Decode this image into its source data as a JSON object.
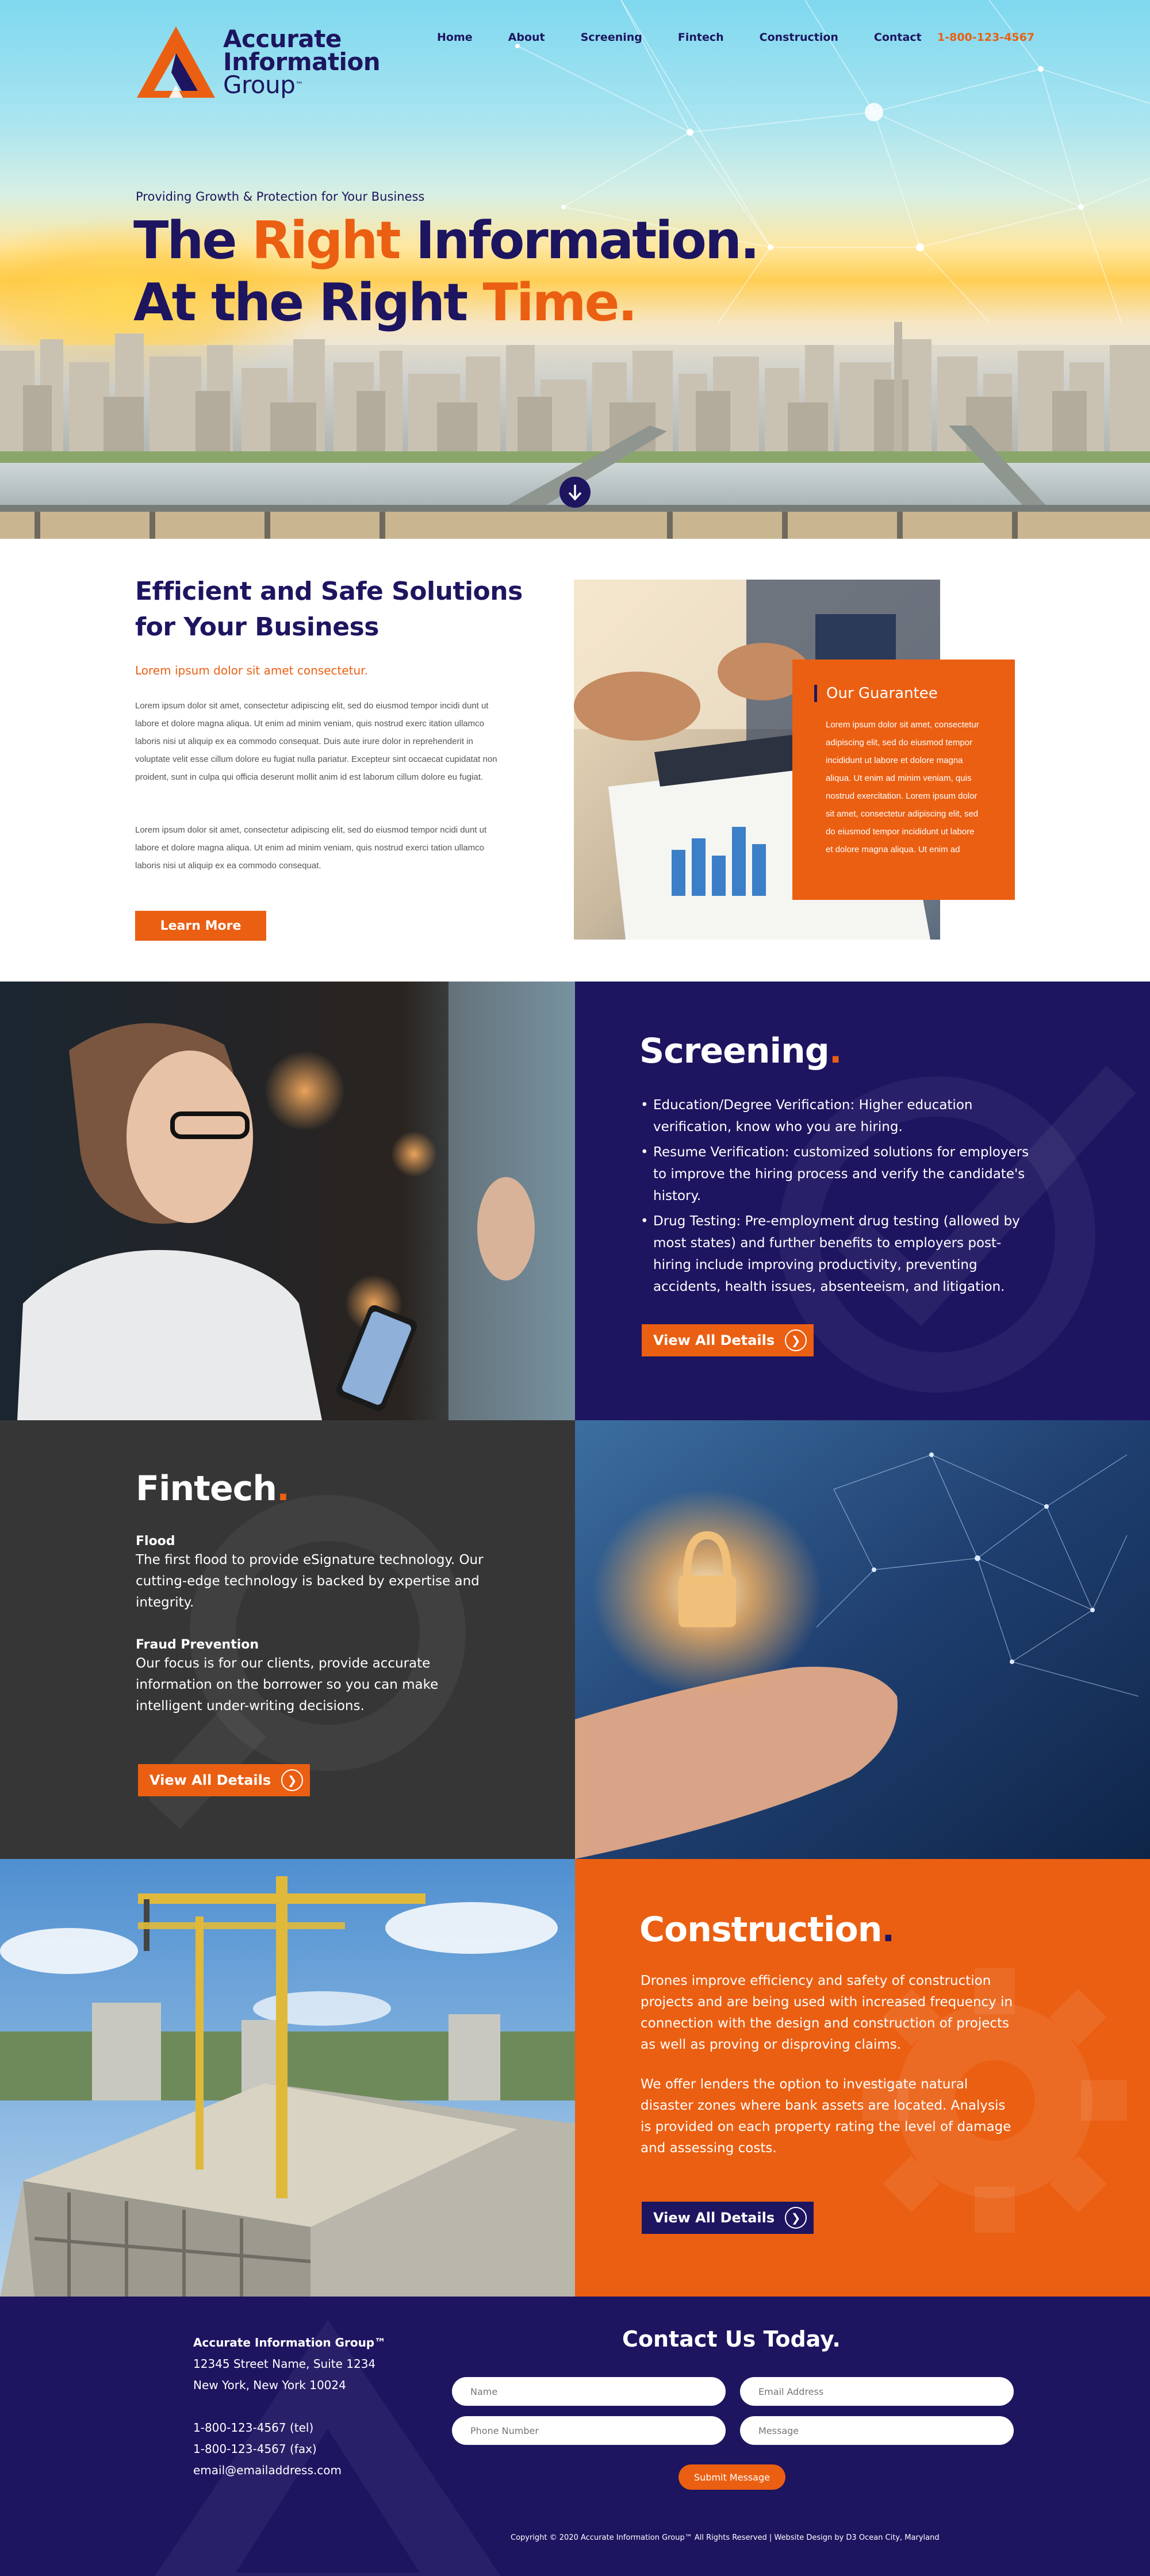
{
  "brand": {
    "line1": "Accurate",
    "line2": "Information",
    "line3": "Group",
    "tm": "™",
    "orange": "#eb5f12",
    "navy": "#1d1560",
    "charcoal": "#363636"
  },
  "nav": {
    "items": [
      {
        "label": "Home"
      },
      {
        "label": "About"
      },
      {
        "label": "Screening"
      },
      {
        "label": "Fintech"
      },
      {
        "label": "Construction"
      },
      {
        "label": "Contact"
      }
    ],
    "phone": "1-800-123-4567"
  },
  "hero": {
    "tagline": "Providing Growth & Protection for Your Business",
    "line1_a": "The ",
    "line1_b": "Right",
    "line1_c": " Information.",
    "line2_a": "At the Right ",
    "line2_b": "Time.",
    "scroll_icon": "arrow-down-icon"
  },
  "intro": {
    "title_line1": "Efficient and Safe Solutions",
    "title_line2": "for Your Business",
    "subtitle": "Lorem ipsum dolor sit amet consectetur.",
    "paragraph1": "Lorem ipsum dolor sit amet, consectetur adipiscing elit, sed do eiusmod tempor incidi dunt ut labore et dolore magna aliqua. Ut enim ad minim veniam, quis nostrud exerc itation ullamco laboris nisi ut aliquip ex ea commodo consequat. Duis aute irure dolor in reprehenderit in voluptate velit esse cillum dolore eu fugiat nulla pariatur. Excepteur sint occaecat cupidatat non proident, sunt in culpa qui officia deserunt mollit anim id est laborum cillum dolore eu fugiat.",
    "paragraph2": "Lorem ipsum dolor sit amet, consectetur adipiscing elit, sed do eiusmod tempor ncidi dunt ut labore et dolore magna aliqua. Ut enim ad minim veniam, quis nostrud exerci tation ullamco laboris nisi ut aliquip ex ea commodo consequat.",
    "button": "Learn More",
    "guarantee_title": "Our Guarantee",
    "guarantee_text": "Lorem ipsum dolor sit amet, consectetur adipiscing elit, sed do eiusmod tempor incididunt ut labore et dolore magna aliqua. Ut enim ad minim veniam, quis nostrud exercitation. Lorem ipsum dolor sit amet, consectetur adipiscing elit, sed do eiusmod tempor incididunt ut labore et dolore magna aliqua. Ut enim ad"
  },
  "screening": {
    "title": "Screening",
    "dot": ".",
    "items": [
      "Education/Degree Verification: Higher education verification, know who you are hiring.",
      "Resume Verification: customized solutions for employers to improve the hiring process and verify the candidate's history.",
      "Drug Testing: Pre-employment drug testing (allowed by most states) and further benefits to employers post-hiring include improving productivity, preventing accidents, health issues, absenteeism, and litigation."
    ],
    "button": "View All Details"
  },
  "fintech": {
    "title": "Fintech",
    "dot": ".",
    "block1_title": "Flood",
    "block1_text": "The first flood to provide eSignature technology. Our cutting-edge technology is backed by expertise and integrity.",
    "block2_title": "Fraud Prevention",
    "block2_text": "Our focus is for our clients, provide accurate information on the borrower so you can make intelligent under-writing decisions.",
    "button": "View All Details"
  },
  "construction": {
    "title": "Construction",
    "dot": ".",
    "paragraph1": "Drones improve efficiency and safety of construction projects and are being used with increased frequency in connection with the design and construction of projects as well as proving or disproving claims.",
    "paragraph2": "We offer lenders the option to investigate natural disaster zones where bank assets are located. Analysis is provided on each property rating the level of damage and assessing costs.",
    "button": "View All Details"
  },
  "footer": {
    "company": "Accurate Information Group™",
    "address1": "12345 Street Name, Suite 1234",
    "address2": "New York, New York 10024",
    "tel": "1-800-123-4567 (tel)",
    "fax": "1-800-123-4567 (fax)",
    "email": "email@emailaddress.com",
    "contact_title": "Contact Us Today.",
    "name_placeholder": "Name",
    "email_placeholder": "Email Address",
    "phone_placeholder": "Phone Number",
    "message_placeholder": "Message",
    "submit": "Submit Message",
    "copyright": "Copyright © 2020 Accurate Information Group™  All Rights Reserved  |  Website Design by D3 Ocean City, Maryland"
  }
}
